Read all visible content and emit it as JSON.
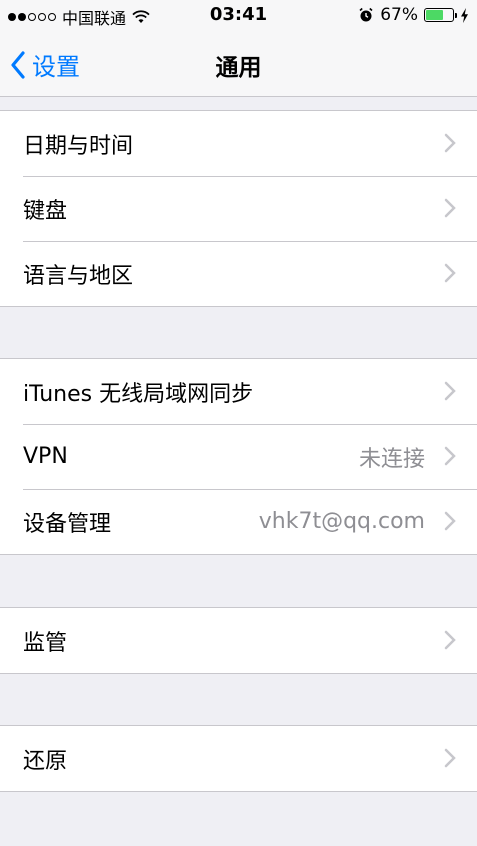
{
  "status_bar": {
    "carrier": "中国联通",
    "time": "03:41",
    "battery_percent": "67%",
    "battery_level": 0.67,
    "signal_bars_filled": 2,
    "signal_bars_total": 5
  },
  "nav": {
    "back_label": "设置",
    "title": "通用"
  },
  "groups": [
    {
      "rows": [
        {
          "label": "日期与时间",
          "value": ""
        },
        {
          "label": "键盘",
          "value": ""
        },
        {
          "label": "语言与地区",
          "value": ""
        }
      ]
    },
    {
      "rows": [
        {
          "label": "iTunes 无线局域网同步",
          "value": ""
        },
        {
          "label": "VPN",
          "value": "未连接"
        },
        {
          "label": "设备管理",
          "value": "vhk7t@qq.com"
        }
      ]
    },
    {
      "rows": [
        {
          "label": "监管",
          "value": ""
        }
      ]
    },
    {
      "rows": [
        {
          "label": "还原",
          "value": ""
        }
      ]
    }
  ],
  "colors": {
    "accent": "#007aff",
    "battery": "#4cd964",
    "background": "#efeff4",
    "secondary_text": "#8e8e93"
  }
}
